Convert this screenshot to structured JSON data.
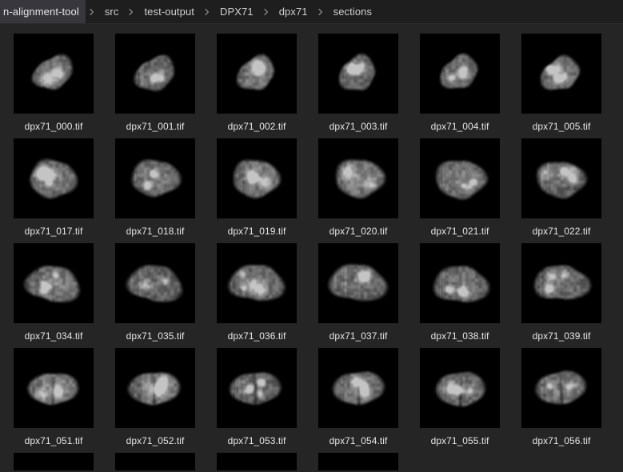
{
  "window": {
    "title": "sections",
    "background": "#252526",
    "breadcrumb_background": "#1e1e1e",
    "label_color": "#e6e6e6",
    "thumbnail_background": "#000000",
    "active_crumb_background": "#37373d"
  },
  "breadcrumb": {
    "separator": "chevron-right-icon",
    "items": [
      {
        "label": "n-alignment-tool",
        "truncated": true,
        "highlighted": true
      },
      {
        "label": "src",
        "truncated": false,
        "highlighted": false
      },
      {
        "label": "test-output",
        "truncated": false,
        "highlighted": false
      },
      {
        "label": "DPX71",
        "truncated": false,
        "highlighted": false
      },
      {
        "label": "dpx71",
        "truncated": false,
        "highlighted": false
      },
      {
        "label": "sections",
        "truncated": false,
        "highlighted": false
      }
    ]
  },
  "grid": {
    "columns": 6,
    "thumbnail_size": 100,
    "rows": [
      {
        "row_index": 0,
        "shape": "oblique-oval",
        "tiles": [
          {
            "label": "dpx71_000.tif",
            "seed": 1000
          },
          {
            "label": "dpx71_001.tif",
            "seed": 1001
          },
          {
            "label": "dpx71_002.tif",
            "seed": 1002
          },
          {
            "label": "dpx71_003.tif",
            "seed": 1003
          },
          {
            "label": "dpx71_004.tif",
            "seed": 1004
          },
          {
            "label": "dpx71_005.tif",
            "seed": 1005
          }
        ]
      },
      {
        "row_index": 1,
        "shape": "wide-round",
        "tiles": [
          {
            "label": "dpx71_017.tif",
            "seed": 1017
          },
          {
            "label": "dpx71_018.tif",
            "seed": 1018
          },
          {
            "label": "dpx71_019.tif",
            "seed": 1019
          },
          {
            "label": "dpx71_020.tif",
            "seed": 1020
          },
          {
            "label": "dpx71_021.tif",
            "seed": 1021
          },
          {
            "label": "dpx71_022.tif",
            "seed": 1022
          }
        ]
      },
      {
        "row_index": 2,
        "shape": "broad-lobed",
        "tiles": [
          {
            "label": "dpx71_034.tif",
            "seed": 1034
          },
          {
            "label": "dpx71_035.tif",
            "seed": 1035
          },
          {
            "label": "dpx71_036.tif",
            "seed": 1036
          },
          {
            "label": "dpx71_037.tif",
            "seed": 1037
          },
          {
            "label": "dpx71_038.tif",
            "seed": 1038
          },
          {
            "label": "dpx71_039.tif",
            "seed": 1039
          }
        ]
      },
      {
        "row_index": 3,
        "shape": "split-midline",
        "tiles": [
          {
            "label": "dpx71_051.tif",
            "seed": 1051
          },
          {
            "label": "dpx71_052.tif",
            "seed": 1052
          },
          {
            "label": "dpx71_053.tif",
            "seed": 1053
          },
          {
            "label": "dpx71_054.tif",
            "seed": 1054
          },
          {
            "label": "dpx71_055.tif",
            "seed": 1055
          },
          {
            "label": "dpx71_056.tif",
            "seed": 1056
          }
        ]
      },
      {
        "row_index": 4,
        "partial": true,
        "shape": "split-midline",
        "tiles": [
          {
            "label": "",
            "seed": 1068
          },
          {
            "label": "",
            "seed": 1069
          },
          {
            "label": "",
            "seed": 1070
          },
          {
            "label": "",
            "seed": 1071
          },
          {
            "label": "",
            "seed": 0,
            "empty": true
          },
          {
            "label": "",
            "seed": 0,
            "empty": true
          }
        ]
      }
    ]
  }
}
